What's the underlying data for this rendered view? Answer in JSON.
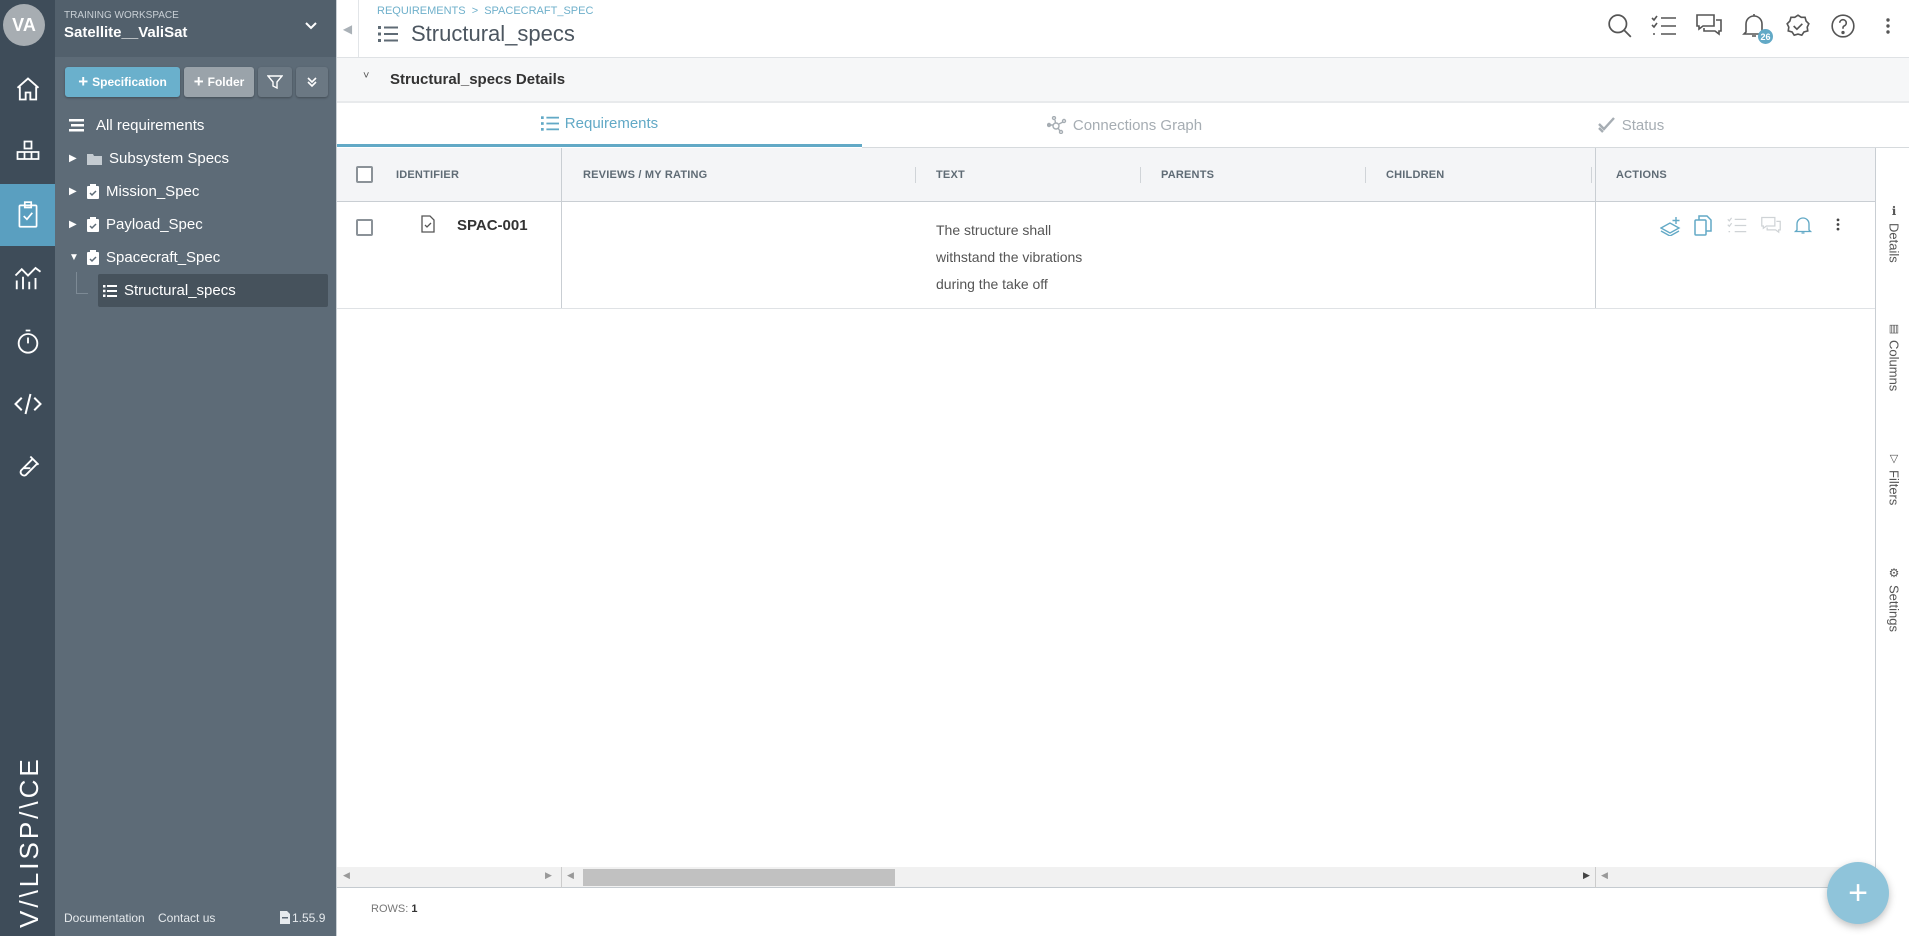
{
  "user": {
    "initials": "VA"
  },
  "brand": {
    "logo_text": "VALISPACE"
  },
  "workspace": {
    "label": "TRAINING WORKSPACE",
    "name": "Satellite__ValiSat"
  },
  "sidebar": {
    "buttons": {
      "specification": "Specification",
      "folder": "Folder"
    },
    "all_requirements": "All requirements",
    "tree": [
      {
        "label": "Subsystem Specs",
        "type": "folder"
      },
      {
        "label": "Mission_Spec",
        "type": "spec"
      },
      {
        "label": "Payload_Spec",
        "type": "spec"
      },
      {
        "label": "Spacecraft_Spec",
        "type": "spec",
        "expanded": true
      },
      {
        "label": "Structural_specs",
        "type": "section",
        "selected": true
      }
    ],
    "footer": {
      "documentation": "Documentation",
      "contact": "Contact us",
      "version": "1.55.9"
    }
  },
  "header": {
    "breadcrumb": [
      "REQUIREMENTS",
      "SPACECRAFT_SPEC"
    ],
    "title": "Structural_specs",
    "notification_count": "26"
  },
  "details": {
    "title": "Structural_specs Details"
  },
  "tabs": [
    {
      "label": "Requirements",
      "active": true
    },
    {
      "label": "Connections Graph"
    },
    {
      "label": "Status"
    }
  ],
  "table": {
    "columns": [
      "IDENTIFIER",
      "REVIEWS / MY RATING",
      "TEXT",
      "PARENTS",
      "CHILDREN",
      "ACTIONS"
    ],
    "rows": [
      {
        "identifier": "SPAC-001",
        "reviews": "",
        "text_lines": [
          "The structure shall",
          "withstand the vibrations",
          "during the take off"
        ],
        "parents": "",
        "children": ""
      }
    ],
    "rows_label": "ROWS:",
    "rows_count": "1"
  },
  "side_panel": {
    "details": "Details",
    "columns": "Columns",
    "filters": "Filters",
    "settings": "Settings"
  },
  "colors": {
    "accent": "#62a9c6",
    "rail": "#3e4c59",
    "sidebar": "#5d6b77"
  }
}
